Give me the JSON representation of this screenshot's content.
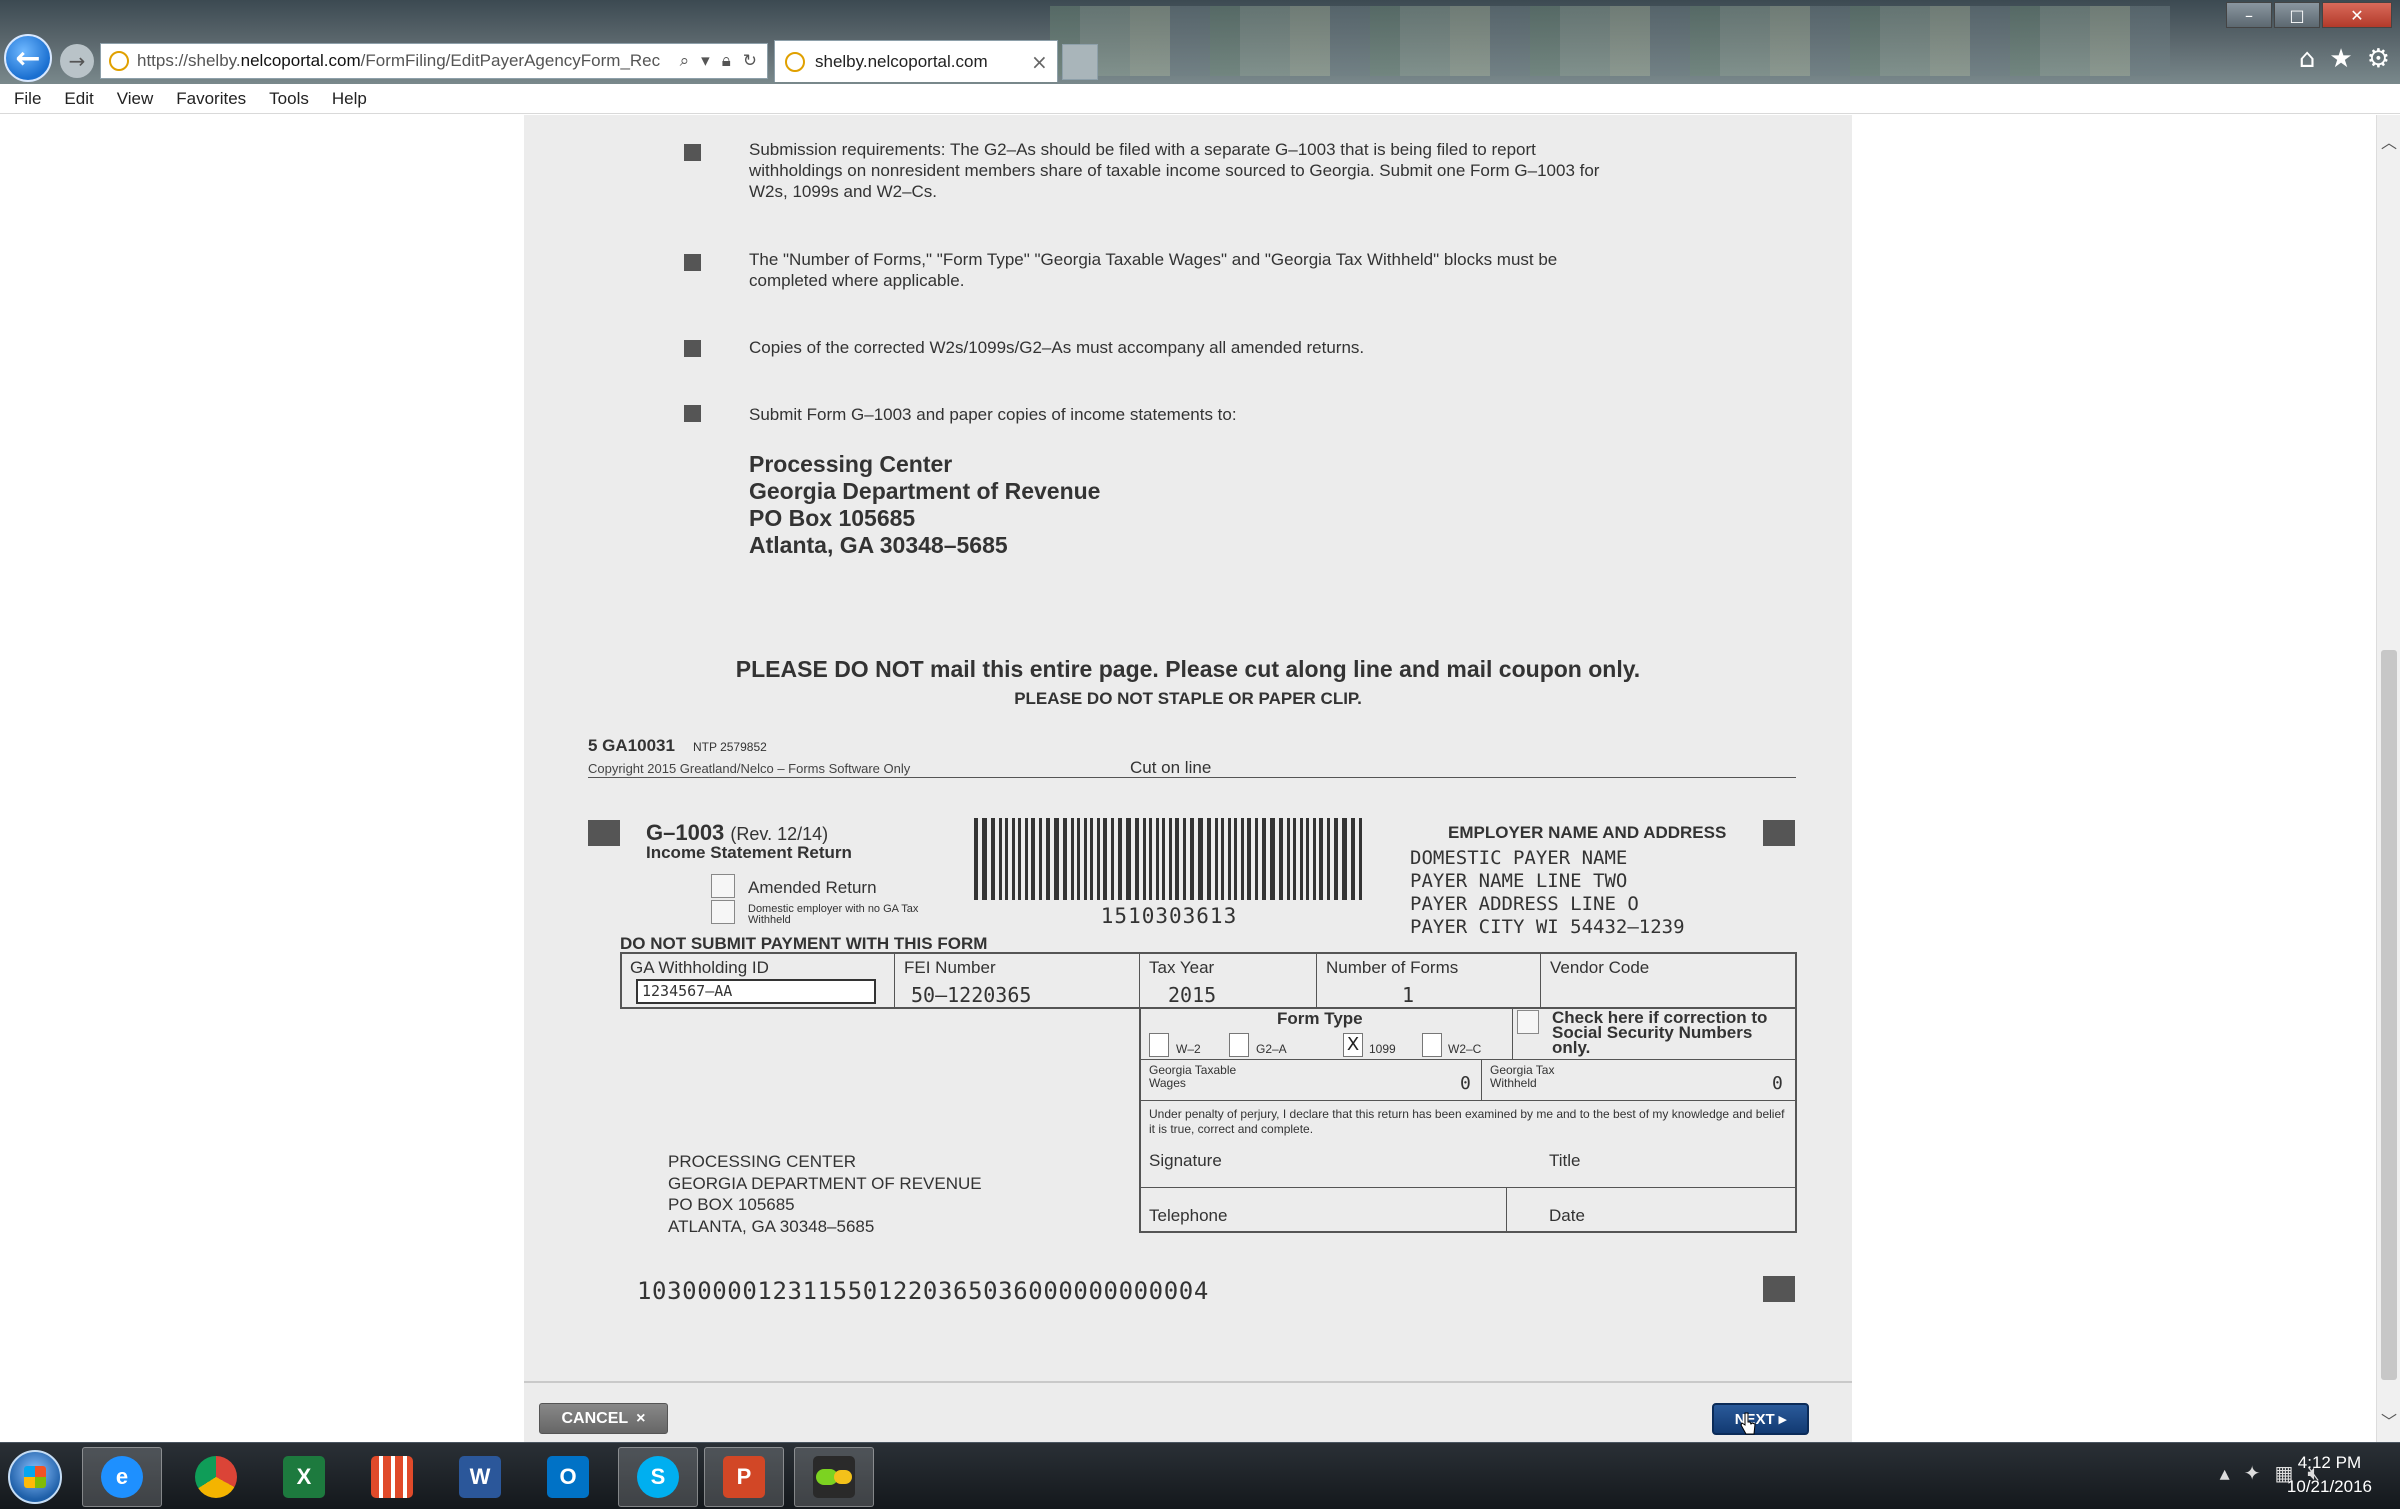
{
  "browser": {
    "url_prefix": "https://shelby.",
    "url_host": "nelcoportal.com",
    "url_path": "/FormFiling/EditPayerAgencyForm_Rec",
    "tab_title": "shelby.nelcoportal.com",
    "window_buttons": [
      "–",
      "□",
      "✕"
    ],
    "menu": [
      "File",
      "Edit",
      "View",
      "Favorites",
      "Tools",
      "Help"
    ]
  },
  "instructions": [
    "Submission requirements: The G2–As should be filed with a separate G–1003 that is being filed to report withholdings on nonresident members share of taxable income sourced to Georgia. Submit one Form G–1003 for W2s, 1099s and W2–Cs.",
    "The \"Number of Forms,\" \"Form Type\" \"Georgia Taxable Wages\" and \"Georgia Tax Withheld\" blocks must be completed where applicable.",
    "Copies of the corrected W2s/1099s/G2–As must accompany all amended returns.",
    "Submit Form G–1003 and paper copies of income statements to:"
  ],
  "mail_address": [
    "Processing Center",
    "Georgia Department of Revenue",
    "PO Box 105685",
    "Atlanta, GA 30348–5685"
  ],
  "notice": {
    "main": "PLEASE DO NOT mail this entire page. Please cut along line and mail coupon only.",
    "sub": "PLEASE DO NOT STAPLE OR PAPER CLIP."
  },
  "form_meta": {
    "code": "5  GA10031",
    "ntp": "NTP 2579852",
    "copyright": "Copyright 2015 Greatland/Nelco – Forms Software Only",
    "cut_label": "Cut on line"
  },
  "coupon": {
    "form_name": "G–1003",
    "rev": "(Rev. 12/14)",
    "subtitle": "Income Statement Return",
    "amended_label": "Amended Return",
    "domestic_label": "Domestic employer with no GA Tax Withheld",
    "barcode_number": "1510303613",
    "employer_title": "EMPLOYER NAME AND ADDRESS",
    "employer_lines": [
      "DOMESTIC PAYER NAME",
      "PAYER NAME LINE TWO",
      "PAYER ADDRESS LINE O",
      "PAYER CITY WI 54432–1239"
    ],
    "do_not_submit": "DO NOT SUBMIT PAYMENT WITH THIS FORM",
    "fields": {
      "ga_withholding_label": "GA Withholding ID",
      "ga_withholding_value": "1234567–AA",
      "fei_label": "FEI Number",
      "fei_value": "50–1220365",
      "tax_year_label": "Tax Year",
      "tax_year_value": "2015",
      "num_forms_label": "Number of Forms",
      "num_forms_value": "1",
      "vendor_label": "Vendor Code"
    },
    "form_type_title": "Form Type",
    "form_types": [
      {
        "label": "W–2",
        "checked": ""
      },
      {
        "label": "G2–A",
        "checked": ""
      },
      {
        "label": "1099",
        "checked": "X"
      },
      {
        "label": "W2–C",
        "checked": ""
      }
    ],
    "check_correction": "Check here if correction to Social Security Numbers only.",
    "taxable_wages_label": "Georgia Taxable Wages",
    "taxable_wages_value": "0",
    "tax_withheld_label": "Georgia Tax Withheld",
    "tax_withheld_value": "0",
    "perjury": "Under penalty of perjury, I declare that this return has been examined by me and to the best of my knowledge and belief it is true, correct and complete.",
    "signature_label": "Signature",
    "title_label": "Title",
    "telephone_label": "Telephone",
    "date_label": "Date",
    "processing_lines": [
      "PROCESSING CENTER",
      "GEORGIA DEPARTMENT OF REVENUE",
      "PO BOX 105685",
      "ATLANTA, GA 30348–5685"
    ],
    "ocr_line": "10300000123115501220365036000000000004"
  },
  "buttons": {
    "cancel": "CANCEL",
    "next": "NEXT"
  },
  "taskbar": {
    "time": "4:12 PM",
    "date": "10/21/2016"
  }
}
